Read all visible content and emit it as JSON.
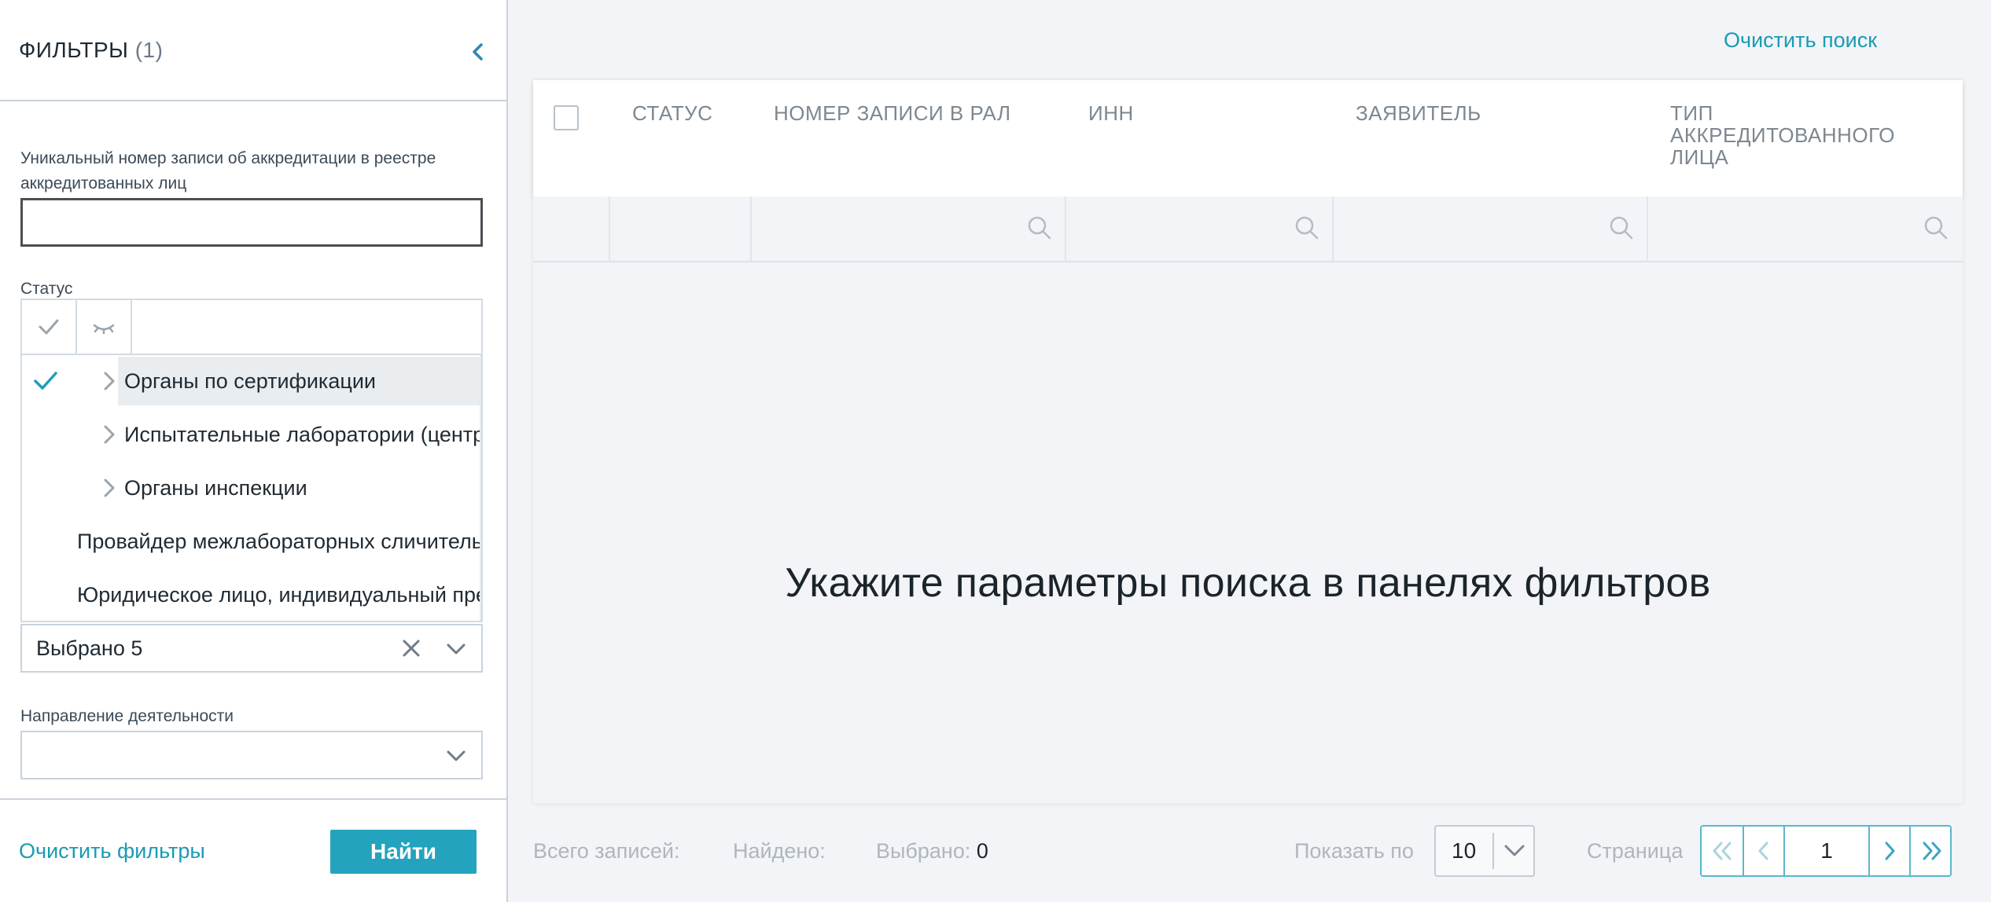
{
  "sidebar": {
    "title": "ФИЛЬТРЫ",
    "filter_count": "(1)",
    "collapse_icon": "chevron-left-icon",
    "fields": {
      "accreditation_number": {
        "label": "Уникальный номер записи об аккредитации в реестре аккредитованных лиц",
        "value": ""
      },
      "status": {
        "label": "Статус",
        "search_value": "",
        "options": [
          {
            "label": "Органы по сертификации",
            "checked": true,
            "expandable": true
          },
          {
            "label": "Испытательные лаборатории (центры)",
            "checked": false,
            "expandable": true
          },
          {
            "label": "Органы инспекции",
            "checked": false,
            "expandable": true
          },
          {
            "label": "Провайдер межлабораторных сличительных испытаний",
            "checked": false,
            "expandable": false
          },
          {
            "label": "Юридическое лицо, индивидуальный предприниматель",
            "checked": false,
            "expandable": false
          }
        ],
        "selected_summary": "Выбрано 5"
      },
      "activity_direction": {
        "label": "Направление деятельности",
        "value": ""
      }
    },
    "clear_filters_label": "Очистить фильтры",
    "find_button_label": "Найти"
  },
  "main": {
    "clear_search_label": "Очистить поиск",
    "table": {
      "columns": [
        {
          "label": "СТАТУС"
        },
        {
          "label": "НОМЕР ЗАПИСИ В РАЛ"
        },
        {
          "label": "ИНН"
        },
        {
          "label": "ЗАЯВИТЕЛЬ"
        },
        {
          "label": "ТИП АККРЕДИТОВАННОГО ЛИЦА"
        }
      ],
      "empty_message": "Укажите параметры поиска в панелях фильтров"
    },
    "footer": {
      "total_label": "Всего записей:",
      "total_value": "",
      "found_label": "Найдено:",
      "found_value": "",
      "selected_label": "Выбрано:",
      "selected_value": "0",
      "per_page_label": "Показать по",
      "per_page_value": "10",
      "page_label": "Страница",
      "current_page": "1"
    }
  },
  "colors": {
    "accent": "#23a3bd",
    "link": "#1a9bb3",
    "background": "#f2f4f7",
    "border": "#c9d3dd"
  }
}
